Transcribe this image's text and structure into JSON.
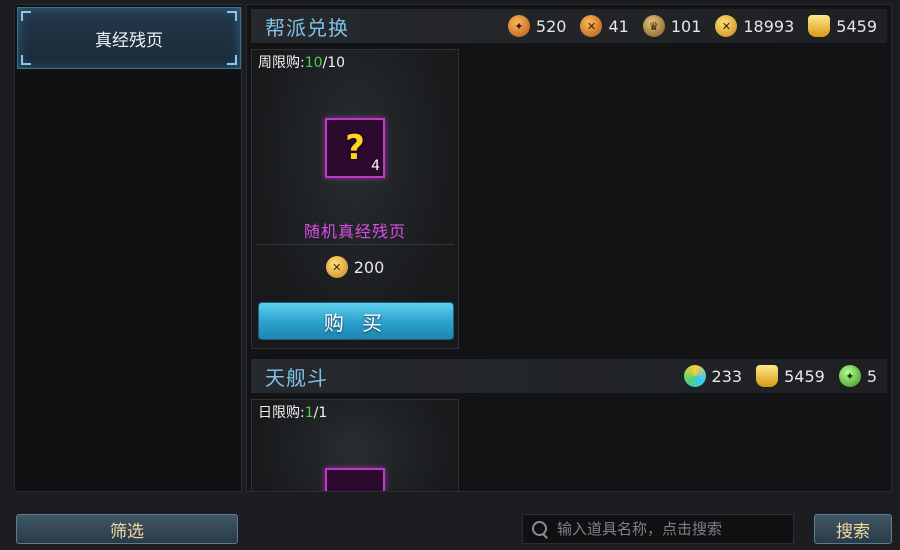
{
  "sidebar": {
    "items": [
      {
        "label": "真经残页",
        "selected": true
      }
    ]
  },
  "sections": [
    {
      "title": "帮派兑换",
      "currencies": [
        {
          "icon": "gang-contribution-icon",
          "value": "520"
        },
        {
          "icon": "gang-badge-icon",
          "value": "41"
        },
        {
          "icon": "gang-token-icon",
          "value": "101"
        },
        {
          "icon": "gold-coin-icon",
          "value": "18993"
        },
        {
          "icon": "gold-ingot-icon",
          "value": "5459"
        }
      ],
      "card": {
        "limit_prefix": "周限购:",
        "limit_current": "10",
        "limit_total": "/10",
        "item_badge": "?",
        "item_count": "4",
        "item_name": "随机真经残页",
        "item_color": "#d84fe6",
        "price_icon": "gold-coin-icon",
        "price": "200",
        "buy_label": "购 买"
      }
    },
    {
      "title": "天舰斗",
      "currencies": [
        {
          "icon": "arena-medal-icon",
          "value": "233"
        },
        {
          "icon": "gold-ingot-icon",
          "value": "5459"
        },
        {
          "icon": "jade-coin-icon",
          "value": "5"
        }
      ],
      "card": {
        "limit_prefix": "日限购:",
        "limit_current": "1",
        "limit_total": "/1"
      }
    }
  ],
  "bottom": {
    "filter_label": "筛选",
    "search_placeholder": "输入道具名称，点击搜索",
    "search_value": "",
    "search_label": "搜索"
  },
  "colors": {
    "accent": "#7fc0ea",
    "limit_current": "#46d24a",
    "buy_button": "#2b9fcb"
  }
}
